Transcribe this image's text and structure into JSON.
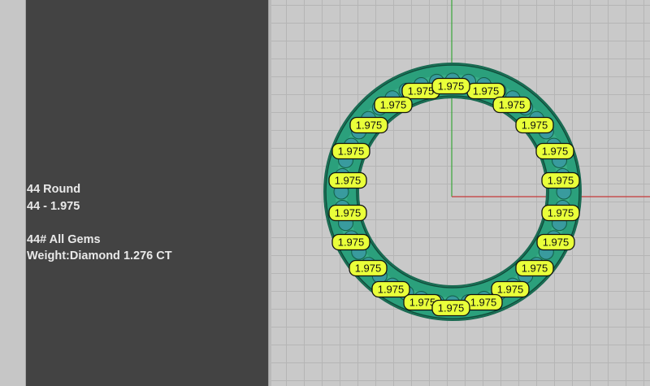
{
  "info": {
    "line1": "44 Round",
    "line2": "44 - 1.975",
    "line3": "44# All Gems",
    "line4": "Weight:Diamond 1.276 CT"
  },
  "gem_labels": [
    "1.975",
    "1.975",
    "1.975",
    "1.975",
    "1.975",
    "1.975",
    "1.975",
    "1.975",
    "1.975",
    "1.975",
    "1.975",
    "1.975",
    "1.975",
    "1.975",
    "1.975",
    "1.975",
    "1.975",
    "1.975",
    "1.975",
    "1.975",
    "1.975",
    "1.975"
  ],
  "colors": {
    "ring_body": "#2ba07c",
    "ring_dark": "#1a6a52",
    "label_fill": "#e9ff3a",
    "axis_x": "#c53a3a",
    "axis_y": "#3aa63a",
    "panel": "#434343",
    "grid": "#b5b5b5"
  }
}
